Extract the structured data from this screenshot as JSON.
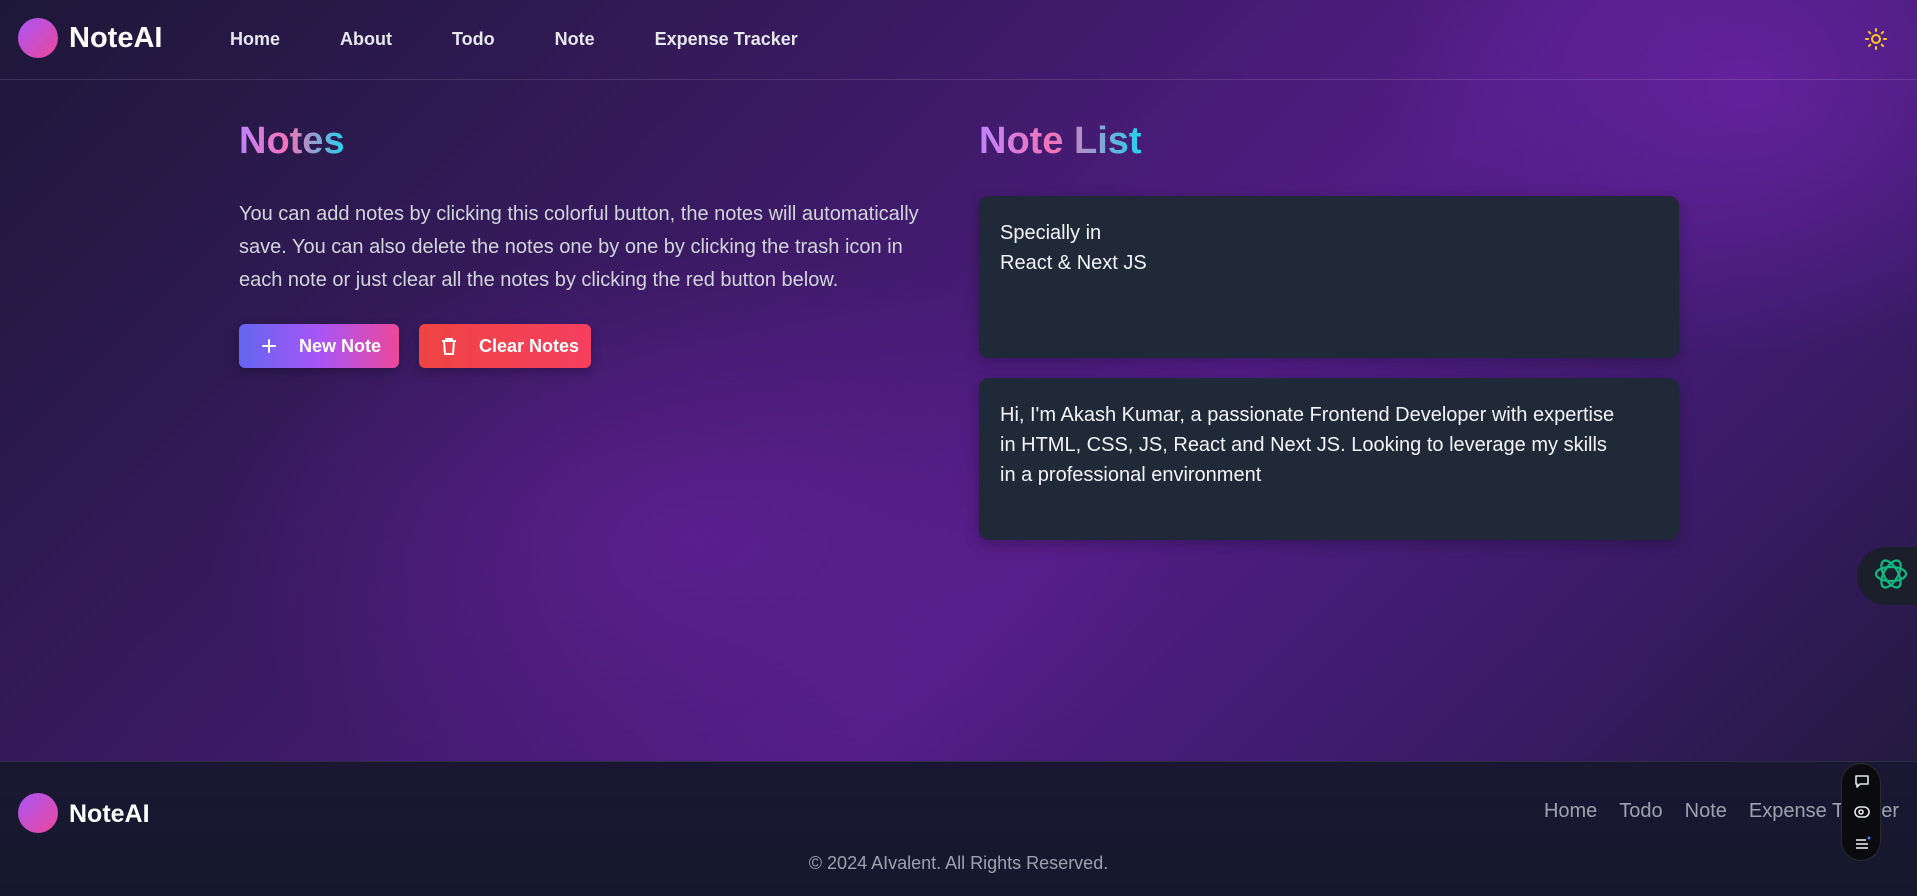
{
  "app": {
    "brand": "NoteAI",
    "nav": [
      "Home",
      "About",
      "Todo",
      "Note",
      "Expense Tracker"
    ],
    "theme_icon": "sun-icon"
  },
  "main": {
    "notes_title": "Notes",
    "notes_description": "You can add notes by clicking this colorful button, the notes will automatically save. You can also delete the notes one by one by clicking the trash icon in each note or just clear all the notes by clicking the red button below.",
    "new_note_label": "New Note",
    "clear_notes_label": "Clear Notes",
    "note_list_title": "Note List",
    "notes": [
      "Specially in\nReact & Next JS",
      "Hi, I'm Akash Kumar, a passionate Frontend Developer with expertise in HTML, CSS, JS, React and Next JS. Looking to leverage my skills in a professional environment"
    ]
  },
  "footer": {
    "brand": "NoteAI",
    "links": [
      "Home",
      "Todo",
      "Note",
      "Expense Tracker"
    ],
    "copyright": "© 2024 AIvalent. All Rights Reserved."
  },
  "colors": {
    "accent_gradient_start": "#6366f1",
    "accent_gradient_end": "#ec4899",
    "danger": "#ef4444",
    "card_bg": "#1f2937",
    "float_icon": "#10b981"
  }
}
